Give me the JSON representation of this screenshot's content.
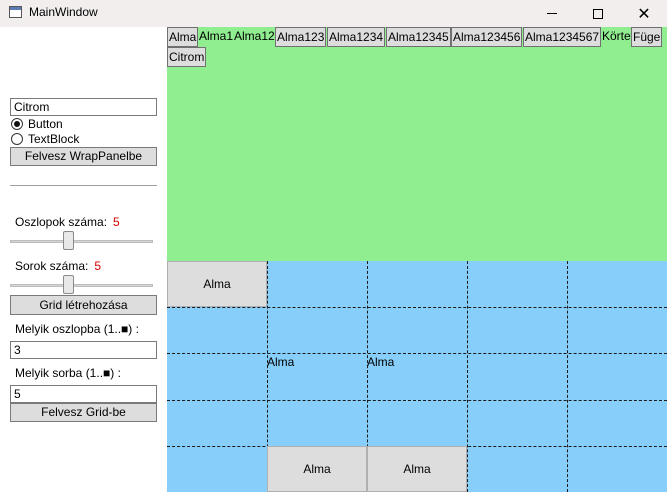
{
  "window": {
    "title": "MainWindow",
    "icon": "window-icon"
  },
  "controls": {
    "new_item_text": "Citrom",
    "radio_button_label": "Button",
    "radio_textblock_label": "TextBlock",
    "radio_selected": "Button",
    "add_to_wrap_label": "Felvesz WrapPanelbe",
    "columns_label": "Oszlopok száma:",
    "columns_value": "5",
    "rows_label": "Sorok száma:",
    "rows_value": "5",
    "columns_slider_fraction": 0.4,
    "rows_slider_fraction": 0.4,
    "create_grid_label": "Grid létrehozása",
    "which_column_label": "Melyik oszlopba (1..■) :",
    "which_column_value": "3",
    "which_row_label": "Melyik sorba (1..■) :",
    "which_row_value": "5",
    "add_to_grid_label": "Felvesz Grid-be"
  },
  "colors": {
    "wrap_bg": "#90ee90",
    "grid_bg": "#87cefa",
    "value_red": "#d40000"
  },
  "wrap_items": [
    {
      "type": "button",
      "text": "Alma"
    },
    {
      "type": "text",
      "text": "Alma1"
    },
    {
      "type": "text",
      "text": "Alma12"
    },
    {
      "type": "button",
      "text": "Alma123"
    },
    {
      "type": "button",
      "text": "Alma1234"
    },
    {
      "type": "button",
      "text": "Alma12345"
    },
    {
      "type": "button",
      "text": "Alma123456"
    },
    {
      "type": "button",
      "text": "Alma1234567"
    },
    {
      "type": "text",
      "text": "Körte"
    },
    {
      "type": "button",
      "text": "Füge"
    },
    {
      "type": "button",
      "text": "Citrom"
    }
  ],
  "grid": {
    "columns": 5,
    "rows": 5,
    "items": [
      {
        "type": "button",
        "text": "Alma",
        "col": 1,
        "row": 1
      },
      {
        "type": "text",
        "text": "Alma",
        "col": 2,
        "row": 3
      },
      {
        "type": "text",
        "text": "Alma",
        "col": 3,
        "row": 3
      },
      {
        "type": "button",
        "text": "Alma",
        "col": 2,
        "row": 5
      },
      {
        "type": "button",
        "text": "Alma",
        "col": 3,
        "row": 5
      }
    ]
  }
}
